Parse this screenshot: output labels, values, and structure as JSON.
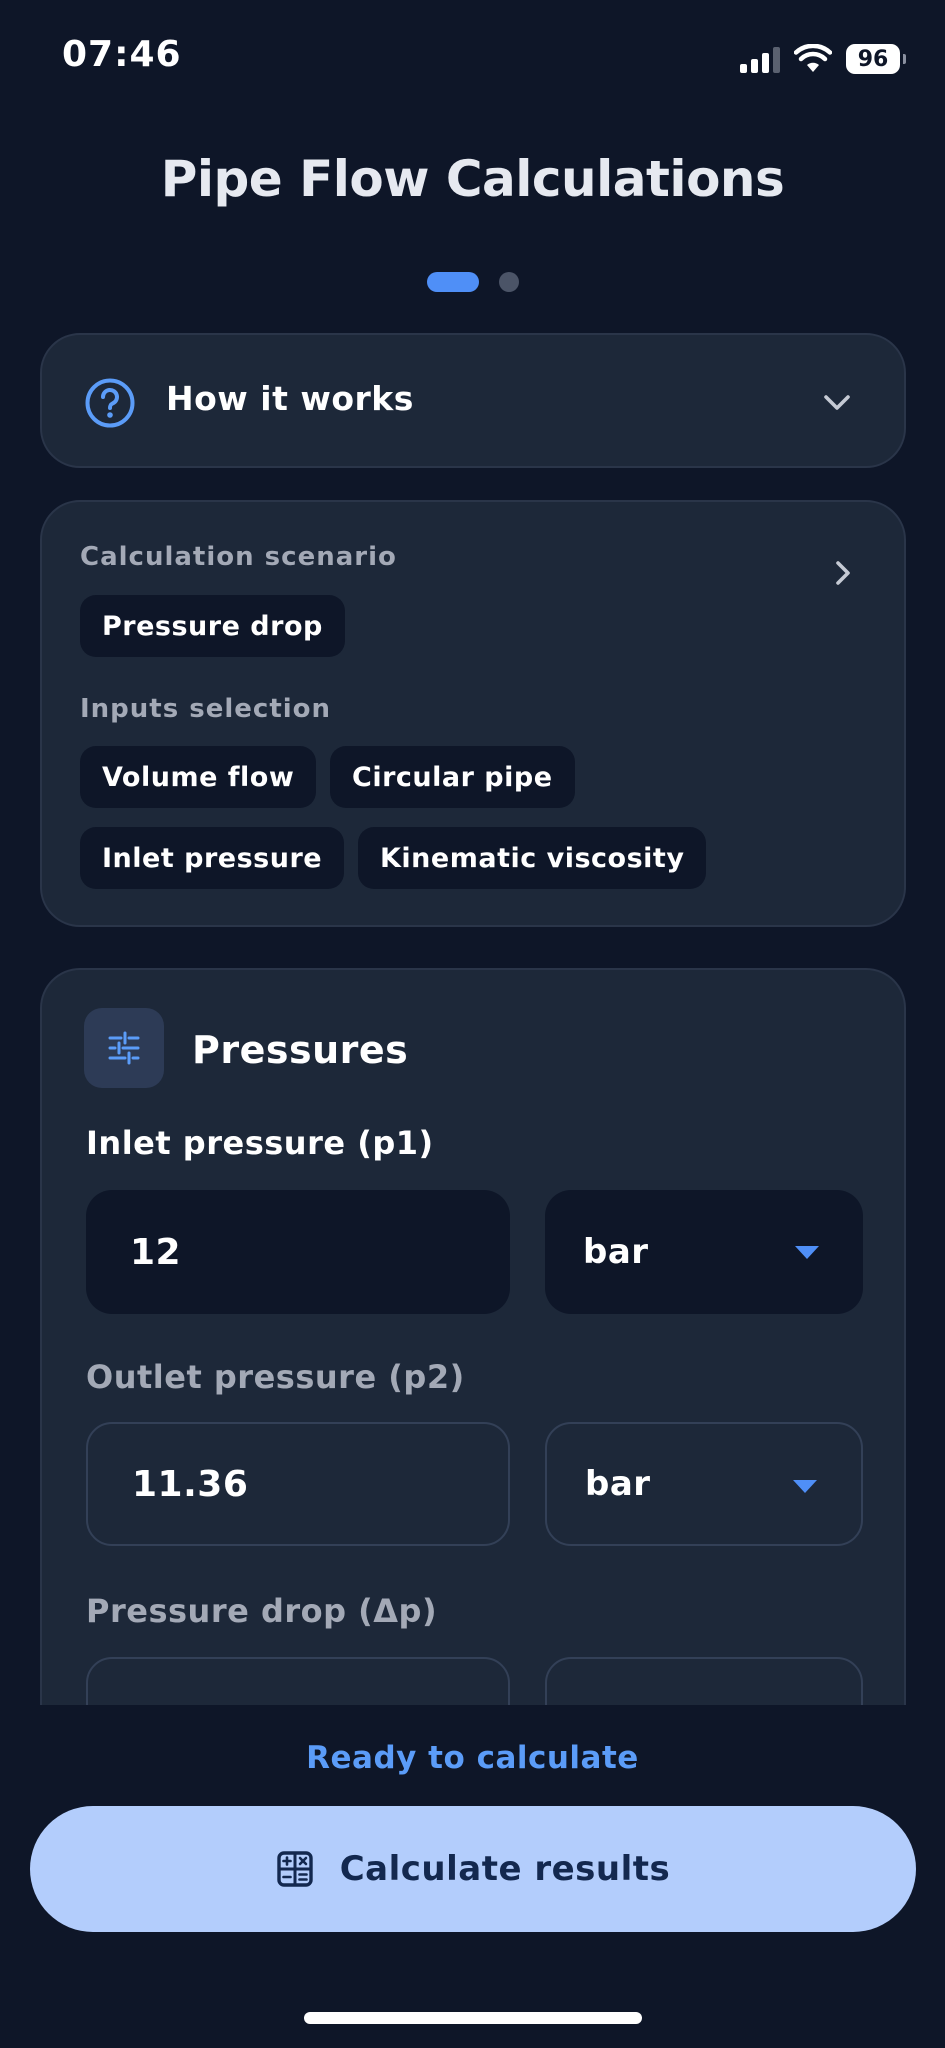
{
  "status_bar": {
    "time": "07:46",
    "battery": "96",
    "icons": [
      "cellular-signal-icon",
      "wifi-icon",
      "battery-icon"
    ]
  },
  "header": {
    "title": "Pipe Flow Calculations",
    "pager": {
      "pages": 2,
      "active_index": 0
    }
  },
  "how_it_works": {
    "label": "How it works",
    "icons": [
      "question-circle-icon",
      "chevron-down-icon"
    ]
  },
  "scenario": {
    "calc_label": "Calculation scenario",
    "calc_value": "Pressure drop",
    "inputs_label": "Inputs selection",
    "inputs": [
      "Volume flow",
      "Circular pipe",
      "Inlet pressure",
      "Kinematic viscosity"
    ],
    "icon": "chevron-right-icon"
  },
  "pressures": {
    "title": "Pressures",
    "icon": "sliders-icon",
    "fields": [
      {
        "label": "Inlet pressure (p1)",
        "value": "12",
        "unit": "bar"
      },
      {
        "label": "Outlet pressure (p2)",
        "value": "11.36",
        "unit": "bar"
      },
      {
        "label": "Pressure drop (Δp)",
        "value": "",
        "unit": ""
      }
    ]
  },
  "footer": {
    "status": "Ready to calculate",
    "button_label": "Calculate results",
    "button_icon": "calculator-icon"
  },
  "colors": {
    "background": "#0e1628",
    "card": "#1d2839",
    "accent": "#4f8ff7",
    "button": "#b3cdfc",
    "button_text": "#13284f",
    "muted_text": "#a3a9b6"
  }
}
